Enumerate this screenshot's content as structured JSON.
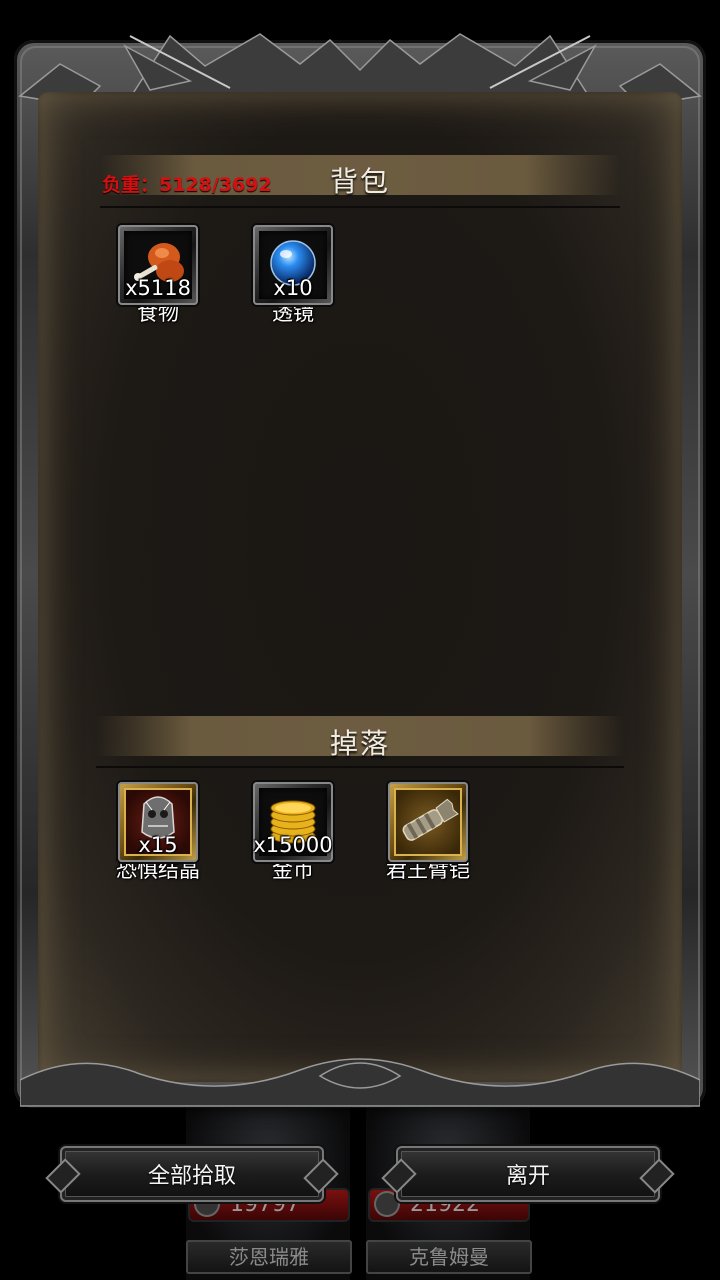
{
  "inventory": {
    "title": "背包",
    "weight_label": "负重：5128/3692",
    "items": [
      {
        "name": "食物",
        "qty": "x5118",
        "icon": "meat-icon"
      },
      {
        "name": "透镜",
        "qty": "x10",
        "icon": "blue-orb-icon"
      }
    ]
  },
  "drops": {
    "title": "掉落",
    "items": [
      {
        "name": "恐惧结晶",
        "qty": "x15",
        "icon": "crystal-skull-icon"
      },
      {
        "name": "金币",
        "qty": "x15000",
        "icon": "gold-coins-icon"
      },
      {
        "name": "君王臂铠",
        "qty": "",
        "icon": "gauntlet-icon"
      }
    ]
  },
  "buttons": {
    "pickup_all": "全部拾取",
    "leave": "离开"
  },
  "background_cards": [
    {
      "hp": "19797",
      "name": "莎恩瑞雅"
    },
    {
      "hp": "21922",
      "name": "克鲁姆曼"
    }
  ],
  "colors": {
    "weight": "#d51010",
    "section_bar": "#6d5c41",
    "parchment": "#1d1915"
  }
}
